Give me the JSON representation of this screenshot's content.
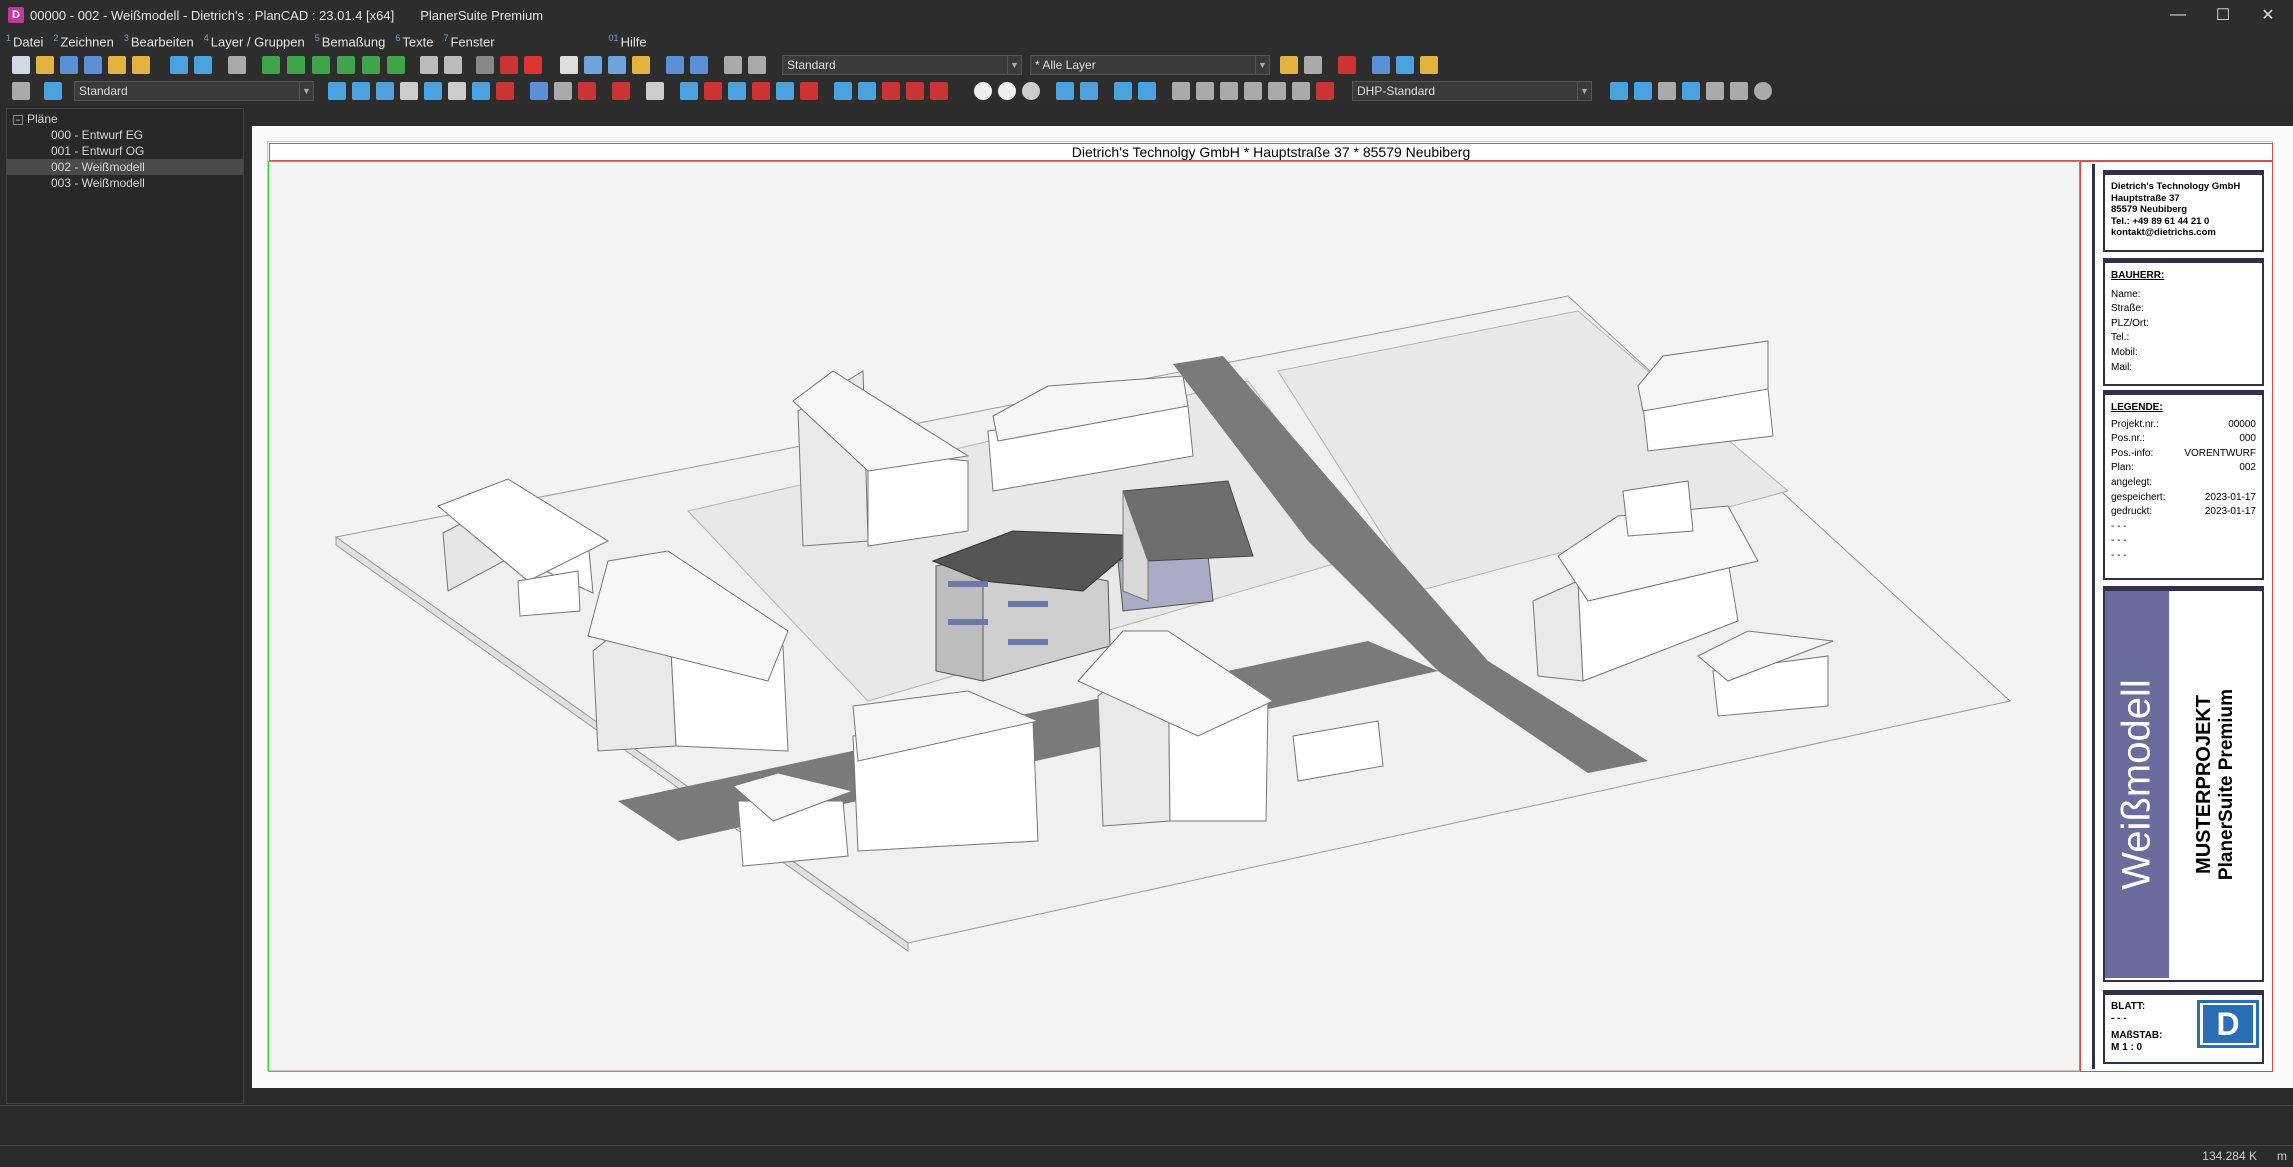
{
  "window": {
    "title": "00000 - 002 - Weißmodell - Dietrich's : PlanCAD : 23.01.4 [x64]",
    "suite": "PlanerSuite Premium",
    "minimize": "—",
    "maximize": "☐",
    "close": "✕"
  },
  "menu": [
    {
      "num": "1",
      "label": "Datei"
    },
    {
      "num": "2",
      "label": "Zeichnen"
    },
    {
      "num": "3",
      "label": "Bearbeiten"
    },
    {
      "num": "4",
      "label": "Layer / Gruppen"
    },
    {
      "num": "5",
      "label": "Bemaßung"
    },
    {
      "num": "6",
      "label": "Texte"
    },
    {
      "num": "7",
      "label": "Fenster"
    },
    {
      "num": "01",
      "label": "Hilfe"
    }
  ],
  "toolbar": {
    "combo_style_top": "Standard",
    "combo_layer": "* Alle Layer",
    "combo_style_left": "Standard",
    "combo_dim": "DHP-Standard"
  },
  "tree": {
    "root": "Pläne",
    "items": [
      "000 - Entwurf EG",
      "001 - Entwurf OG",
      "002 - Weißmodell",
      "003 - Weißmodell"
    ],
    "selected_index": 2
  },
  "sheet": {
    "header": "Dietrich's Technolgy GmbH * Hauptstraße 37 * 85579 Neubiberg",
    "company": [
      "Dietrich's Technology GmbH",
      "Hauptstraße 37",
      "85579 Neubiberg",
      "Tel.: +49 89 61 44 21 0",
      "kontakt@dietrichs.com"
    ],
    "bauherr_title": "BAUHERR:",
    "bauherr_fields": [
      "Name:",
      "Straße:",
      "PLZ/Ort:",
      "Tel.:",
      "Mobil:",
      "Mail:"
    ],
    "legende_title": "LEGENDE:",
    "legende": [
      {
        "label": "Projekt.nr.:",
        "value": "00000"
      },
      {
        "label": "Pos.nr.:",
        "value": "000"
      },
      {
        "label": "Pos.-info:",
        "value": "VORENTWURF"
      },
      {
        "label": "Plan:",
        "value": "002"
      },
      {
        "label": "angelegt:",
        "value": ""
      },
      {
        "label": "gespeichert:",
        "value": "2023-01-17"
      },
      {
        "label": "gedruckt:",
        "value": "2023-01-17"
      },
      {
        "label": "- - -",
        "value": ""
      },
      {
        "label": "- - -",
        "value": ""
      },
      {
        "label": "- - -",
        "value": ""
      }
    ],
    "vertical_title": "Weißmodell",
    "vertical_project": "MUSTERPROJEKT",
    "vertical_suite": "PlanerSuite Premium",
    "blatt_label": "BLATT:",
    "blatt_value": "- - -",
    "massstab_label": "MAßSTAB:",
    "massstab_value": "M 1 : 0",
    "logo_letter": "D",
    "accent": "#6b6b9e"
  },
  "status": {
    "memory": "134.284 K",
    "unit": "m"
  }
}
